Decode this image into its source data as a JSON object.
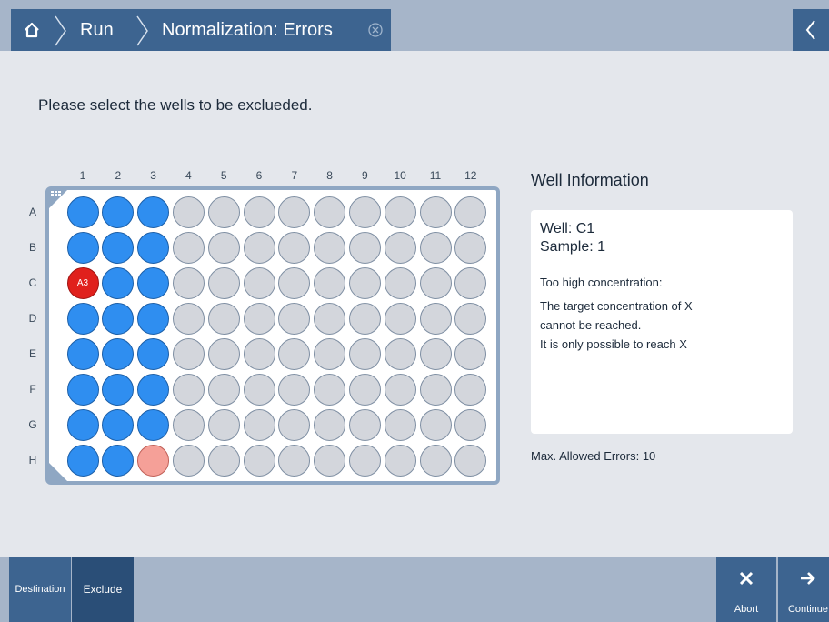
{
  "header": {
    "home_icon": "home-icon",
    "breadcrumbs": [
      "Run",
      "Normalization: Errors"
    ],
    "close_icon": "close-circle-icon",
    "back_icon": "chevron-left-icon"
  },
  "instruction": "Please select the wells to be exclueded.",
  "plate": {
    "columns": [
      "1",
      "2",
      "3",
      "4",
      "5",
      "6",
      "7",
      "8",
      "9",
      "10",
      "11",
      "12"
    ],
    "rows": [
      "A",
      "B",
      "C",
      "D",
      "E",
      "F",
      "G",
      "H"
    ],
    "colors": {
      "selected": "#2f8ef0",
      "error": "#e0201c",
      "warning": "#f5a098",
      "empty": "#d3d6dc"
    },
    "wells": [
      [
        "selected",
        "selected",
        "selected",
        "empty",
        "empty",
        "empty",
        "empty",
        "empty",
        "empty",
        "empty",
        "empty",
        "empty"
      ],
      [
        "selected",
        "selected",
        "selected",
        "empty",
        "empty",
        "empty",
        "empty",
        "empty",
        "empty",
        "empty",
        "empty",
        "empty"
      ],
      [
        "error",
        "selected",
        "selected",
        "empty",
        "empty",
        "empty",
        "empty",
        "empty",
        "empty",
        "empty",
        "empty",
        "empty"
      ],
      [
        "selected",
        "selected",
        "selected",
        "empty",
        "empty",
        "empty",
        "empty",
        "empty",
        "empty",
        "empty",
        "empty",
        "empty"
      ],
      [
        "selected",
        "selected",
        "selected",
        "empty",
        "empty",
        "empty",
        "empty",
        "empty",
        "empty",
        "empty",
        "empty",
        "empty"
      ],
      [
        "selected",
        "selected",
        "selected",
        "empty",
        "empty",
        "empty",
        "empty",
        "empty",
        "empty",
        "empty",
        "empty",
        "empty"
      ],
      [
        "selected",
        "selected",
        "selected",
        "empty",
        "empty",
        "empty",
        "empty",
        "empty",
        "empty",
        "empty",
        "empty",
        "empty"
      ],
      [
        "selected",
        "selected",
        "warning",
        "empty",
        "empty",
        "empty",
        "empty",
        "empty",
        "empty",
        "empty",
        "empty",
        "empty"
      ]
    ],
    "error_well_label": "A3"
  },
  "well_info": {
    "title": "Well Information",
    "well": "Well: C1",
    "sample": "Sample: 1",
    "error_title": "Too high concentration:",
    "lines": [
      "The target concentration of X",
      "cannot be reached.",
      "It is only possible to reach X"
    ]
  },
  "max_errors": "Max. Allowed Errors: 10",
  "bottom": {
    "tabs": [
      "Destination",
      "Exclude"
    ],
    "abort_label": "Abort",
    "continue_label": "Continue"
  }
}
